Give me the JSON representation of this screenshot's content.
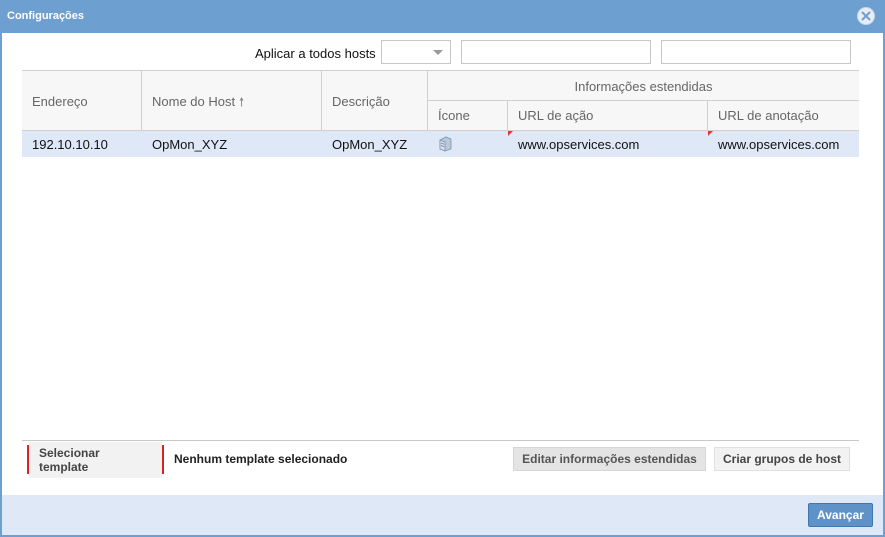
{
  "window": {
    "title": "Configurações"
  },
  "apply_all": {
    "label": "Aplicar a todos hosts",
    "select_value": "",
    "input1_value": "",
    "input2_value": ""
  },
  "grid": {
    "columns": {
      "address": "Endereço",
      "host_name": "Nome do Host",
      "host_name_sort": "🠕",
      "description": "Descrição",
      "extended_group": "Informações estendidas",
      "icon": "Ícone",
      "action_url": "URL de ação",
      "notes_url": "URL de anotação"
    },
    "rows": [
      {
        "address": "192.10.10.10",
        "host_name": "OpMon_XYZ",
        "description": "OpMon_XYZ",
        "icon": "server-icon",
        "action_url": "www.opservices.com",
        "notes_url": "www.opservices.com"
      }
    ]
  },
  "footer": {
    "select_template": "Selecionar template",
    "no_template": "Nenhum template selecionado",
    "edit_extended": "Editar informações estendidas",
    "create_groups": "Criar grupos de host",
    "next": "Avançar"
  },
  "colors": {
    "title_bar": "#6d9fd0",
    "selected_row": "#dfe8f6",
    "highlight_border": "#e02020",
    "primary_button": "#5f93c8"
  }
}
